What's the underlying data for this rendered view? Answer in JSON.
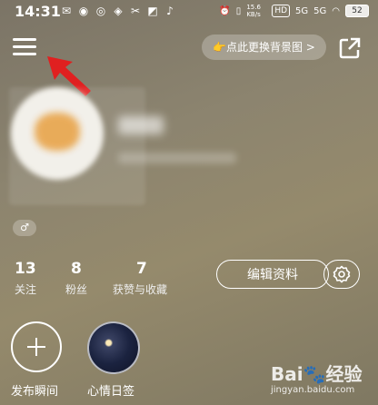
{
  "status_bar": {
    "time": "14:31",
    "net_speed": "15.6 KB/s",
    "hd_badge": "HD",
    "signal_1": "5G",
    "signal_2": "5G",
    "battery": "52"
  },
  "header": {
    "change_bg_label": "👉点此更换背景图 >"
  },
  "profile": {
    "gender_symbol": "♂"
  },
  "stats": [
    {
      "num": "13",
      "label": "关注"
    },
    {
      "num": "8",
      "label": "粉丝"
    },
    {
      "num": "7",
      "label": "获赞与收藏"
    }
  ],
  "actions": {
    "edit_label": "编辑资料"
  },
  "bottom_items": [
    {
      "label": "发布瞬间"
    },
    {
      "label": "心情日签"
    }
  ],
  "watermark": {
    "brand": "Bai🐾经验",
    "url": "jingyan.baidu.com"
  },
  "colors": {
    "arrow": "#e02020"
  }
}
